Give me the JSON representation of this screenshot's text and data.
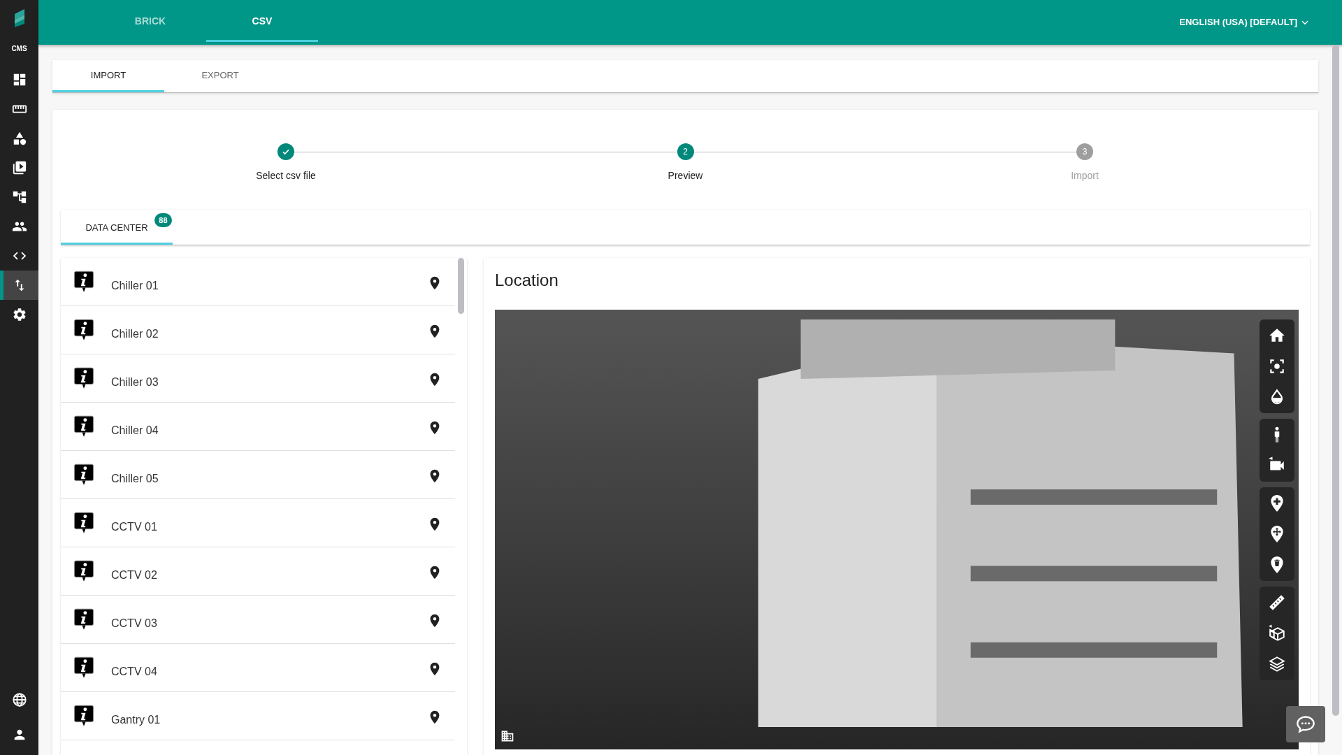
{
  "sidebar": {
    "logo_text": "CMS",
    "items": [
      {
        "kind": "dashboard",
        "selected": false
      },
      {
        "kind": "ruler",
        "selected": false
      },
      {
        "kind": "shapes",
        "selected": false
      },
      {
        "kind": "media",
        "selected": false
      },
      {
        "kind": "tree",
        "selected": false
      },
      {
        "kind": "people",
        "selected": false
      },
      {
        "kind": "code",
        "selected": false
      },
      {
        "kind": "transfer",
        "selected": true
      },
      {
        "kind": "settings",
        "selected": false
      }
    ],
    "bottom_items": [
      {
        "kind": "globe"
      },
      {
        "kind": "user"
      }
    ]
  },
  "top_tabs": [
    {
      "label": "BRICK",
      "selected": false
    },
    {
      "label": "CSV",
      "selected": true
    }
  ],
  "language": "ENGLISH (USA) [DEFAULT]",
  "sub_tabs": [
    {
      "label": "IMPORT",
      "selected": true
    },
    {
      "label": "EXPORT",
      "selected": false
    }
  ],
  "stepper": [
    {
      "label": "Select csv file",
      "done": true,
      "selected": false
    },
    {
      "number": "2",
      "label": "Preview",
      "done": false,
      "selected": true
    },
    {
      "number": "3",
      "label": "Import",
      "done": false,
      "selected": false
    }
  ],
  "category_tabs": [
    {
      "label": "DATA CENTER",
      "badge": "88",
      "selected": true
    }
  ],
  "devices": [
    {
      "name": "Chiller 01"
    },
    {
      "name": "Chiller 02"
    },
    {
      "name": "Chiller 03"
    },
    {
      "name": "Chiller 04"
    },
    {
      "name": "Chiller 05"
    },
    {
      "name": "CCTV 01"
    },
    {
      "name": "CCTV 02"
    },
    {
      "name": "CCTV 03"
    },
    {
      "name": "CCTV 04"
    },
    {
      "name": "Gantry 01"
    }
  ],
  "location": {
    "title": "Location",
    "toolbar": [
      [
        {
          "kind": "home"
        },
        {
          "kind": "focus"
        },
        {
          "kind": "drop"
        }
      ],
      [
        {
          "kind": "walk"
        },
        {
          "kind": "camera"
        }
      ],
      [
        {
          "kind": "pin-add"
        },
        {
          "kind": "pin-move"
        },
        {
          "kind": "pin-delete"
        }
      ],
      [
        {
          "kind": "ruler"
        },
        {
          "kind": "section"
        },
        {
          "kind": "layers"
        }
      ]
    ]
  }
}
